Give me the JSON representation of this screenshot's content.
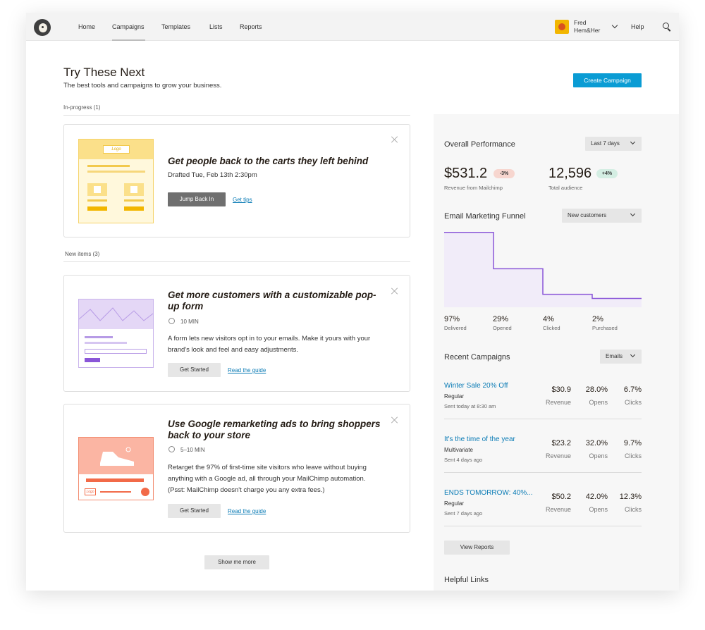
{
  "nav": {
    "items": [
      "Home",
      "Campaigns",
      "Templates",
      "Lists",
      "Reports"
    ],
    "active": "Campaigns",
    "user_line1": "Fred",
    "user_line2": "Hem&Her",
    "help": "Help"
  },
  "header": {
    "title": "Try These Next",
    "subtitle": "The best tools and campaigns to grow your business.",
    "create_button": "Create Campaign"
  },
  "inprogress": {
    "label": "In-progress (1)",
    "card": {
      "title": "Get people back to the carts they left behind",
      "meta": "Drafted Tue, Feb 13th 2:30pm",
      "primary": "Jump Back In",
      "link": "Get tips",
      "thumb_logo": "Logo"
    }
  },
  "newitems": {
    "label": "New items (3)",
    "cards": [
      {
        "title_line1": "Get more customers with a customizable pop-",
        "title_line2": "up form",
        "time": "10 MIN",
        "desc_line1": "A form lets new visitors opt in to your emails. Make it yours with your",
        "desc_line2": "brand's look and feel and easy adjustments.",
        "primary": "Get Started",
        "link": "Read the guide"
      },
      {
        "title_line1": "Use Google remarketing ads to bring shoppers",
        "title_line2": "back to your store",
        "time": "5–10 MIN",
        "desc_line1": "Retarget the 97% of first-time site visitors who leave without buying",
        "desc_line2": "anything with a Google ad, all through your MailChimp automation.",
        "desc_line3": "(Psst: MailChimp doesn't charge you any extra fees.)",
        "primary": "Get Started",
        "link": "Read the guide",
        "thumb_logo": "Logo"
      }
    ],
    "show_more": "Show me more"
  },
  "performance": {
    "title": "Overall Performance",
    "range": "Last 7 days",
    "revenue": "$531.2",
    "revenue_change": "-3%",
    "revenue_label": "Revenue from Mailchimp",
    "audience": "12,596",
    "audience_change": "+4%",
    "audience_label": "Total audience"
  },
  "funnel": {
    "title": "Email Marketing Funnel",
    "segment": "New customers",
    "stages": [
      {
        "pct": "97%",
        "label": "Delivered",
        "value": 97
      },
      {
        "pct": "29%",
        "label": "Opened",
        "value": 29
      },
      {
        "pct": "4%",
        "label": "Clicked",
        "value": 4
      },
      {
        "pct": "2%",
        "label": "Purchased",
        "value": 2
      }
    ]
  },
  "recent": {
    "title": "Recent Campaigns",
    "filter": "Emails",
    "col_labels": [
      "Revenue",
      "Opens",
      "Clicks"
    ],
    "campaigns": [
      {
        "name": "Winter Sale 20% Off",
        "type": "Regular",
        "date": "Sent today at 8:30 am",
        "revenue": "$30.9",
        "opens": "28.0%",
        "clicks": "6.7%"
      },
      {
        "name": "It's the time of the year",
        "type": "Multivariate",
        "date": "Sent 4 days ago",
        "revenue": "$23.2",
        "opens": "32.0%",
        "clicks": "9.7%"
      },
      {
        "name": "ENDS TOMORROW: 40%...",
        "type": "Regular",
        "date": "Sent 7 days ago",
        "revenue": "$50.2",
        "opens": "42.0%",
        "clicks": "12.3%"
      }
    ],
    "view_reports": "View Reports"
  },
  "helpful": {
    "title": "Helpful Links"
  },
  "colors": {
    "accent": "#0a9cd4",
    "link": "#0a7bb5",
    "funnel_line": "#8a56d8",
    "funnel_fill": "#f1ecf9",
    "negative_badge": "#f7d6cf",
    "positive_badge": "#d4eee3"
  }
}
